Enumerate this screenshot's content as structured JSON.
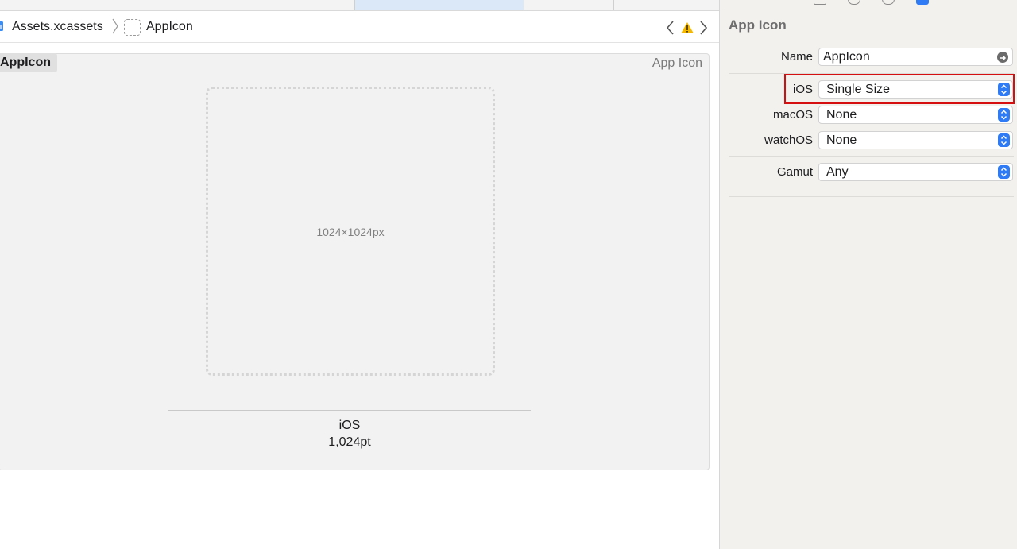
{
  "jumpbar": {
    "crumbs": [
      "Assets.xcassets",
      "AppIcon"
    ],
    "warning_color": "#f5b800"
  },
  "asset": {
    "name": "AppIcon",
    "type_label": "App Icon",
    "well_size": "1024×1024px",
    "slot_platform": "iOS",
    "slot_size": "1,024pt"
  },
  "inspector": {
    "title": "App Icon",
    "name_label": "Name",
    "name_value": "AppIcon",
    "ios_label": "iOS",
    "ios_value": "Single Size",
    "macos_label": "macOS",
    "macos_value": "None",
    "watchos_label": "watchOS",
    "watchos_value": "None",
    "gamut_label": "Gamut",
    "gamut_value": "Any",
    "accent_color": "#2f7bf5",
    "highlight_color": "#d50f0f"
  }
}
